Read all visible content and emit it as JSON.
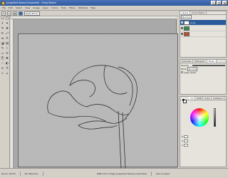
{
  "window": {
    "title": "[ungolded flower] (imported) - Gimp-Sketch",
    "controls": [
      "–",
      "□",
      "×"
    ]
  },
  "menubar": [
    "File",
    "Edit",
    "Select",
    "View",
    "Image",
    "Layer",
    "Colors",
    "Tools",
    "Filters",
    "Windows",
    "Help"
  ],
  "options_bar": {
    "tool_items": [
      "▭",
      "◫",
      "▣"
    ],
    "mode_value": "Right Brush",
    "mode_color": "#2a6aa8"
  },
  "toolbox": {
    "tools": [
      {
        "icon": "rect-select-icon",
        "glyph": "▭"
      },
      {
        "icon": "ellipse-select-icon",
        "glyph": "◯"
      },
      {
        "icon": "lasso-icon",
        "glyph": "ℓ"
      },
      {
        "icon": "wand-icon",
        "glyph": "✦"
      },
      {
        "icon": "crop-icon",
        "glyph": "⌗"
      },
      {
        "icon": "move-icon",
        "glyph": "✥"
      },
      {
        "icon": "rotate-icon",
        "glyph": "↻"
      },
      {
        "icon": "scale-icon",
        "glyph": "⤢"
      },
      {
        "icon": "flip-icon",
        "glyph": "⇋"
      },
      {
        "icon": "text-icon",
        "glyph": "A"
      },
      {
        "icon": "bucket-icon",
        "glyph": "◪"
      },
      {
        "icon": "gradient-icon",
        "glyph": "▤"
      },
      {
        "icon": "pencil-icon",
        "glyph": "✎"
      },
      {
        "icon": "brush-icon",
        "glyph": "⌇"
      },
      {
        "icon": "eraser-icon",
        "glyph": "▱"
      },
      {
        "icon": "airbrush-icon",
        "glyph": "≋"
      },
      {
        "icon": "clone-icon",
        "glyph": "⎘"
      },
      {
        "icon": "heal-icon",
        "glyph": "✚"
      },
      {
        "icon": "smudge-icon",
        "glyph": "☝"
      },
      {
        "icon": "dodge-icon",
        "glyph": "◐"
      },
      {
        "icon": "path-icon",
        "glyph": "⟡"
      },
      {
        "icon": "picker-icon",
        "glyph": "⚲"
      },
      {
        "icon": "zoom-icon",
        "glyph": "⌕"
      },
      {
        "icon": "measure-icon",
        "glyph": "⟂"
      }
    ]
  },
  "panels": {
    "layers": {
      "tabs": [
        "Layers",
        "Undo History"
      ],
      "mode_label": "Normal",
      "layers": [
        {
          "name": "Lines",
          "selected": true,
          "thumb": "#ffffff"
        },
        {
          "name": "",
          "selected": false,
          "thumb": "#2f8f3f"
        },
        {
          "name": "",
          "selected": false,
          "thumb": "#c84a2a"
        }
      ]
    },
    "brush": {
      "tabs": [
        "Overview",
        "Histogram",
        "Brush"
      ],
      "rows": [
        {
          "label": "Opacity",
          "value": ""
        },
        {
          "label": "Mode",
          "value": "Normal"
        },
        {
          "label": "",
          "value": "Apply wheel"
        }
      ]
    },
    "color": {
      "tabs": [
        "Col",
        "RGB",
        "Grey",
        "Cartesian"
      ],
      "fields": [
        "H",
        "S",
        "V"
      ]
    }
  },
  "status": {
    "zoom": "Zoom: 25.0%",
    "selection": "No Selection",
    "image_info": "RGB Color Image [ungolded flower] (imported)",
    "hint": "Click to paint"
  }
}
